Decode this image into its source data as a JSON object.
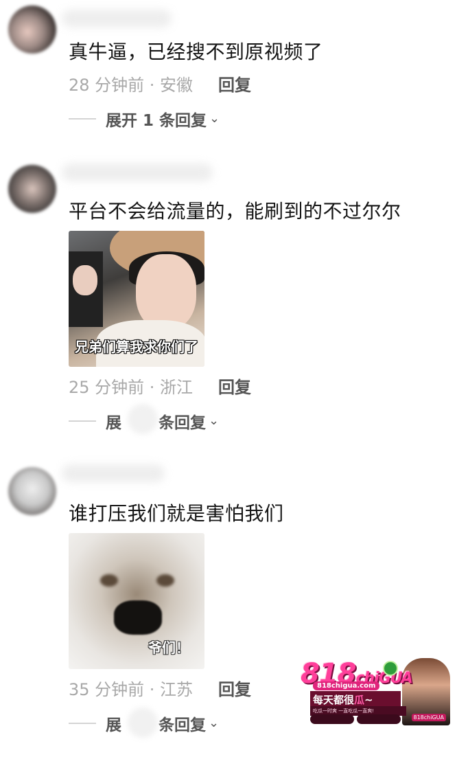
{
  "comments": [
    {
      "text": "真牛逼，已经搜不到原视频了",
      "meta": "28 分钟前 · 安徽",
      "reply_label": "回复",
      "expand_label": "展开 1 条回复",
      "expand_chevron": "⌄"
    },
    {
      "text": "平台不会给流量的，能刷到的不过尔尔",
      "sticker_caption": "兄弟们算我求你们了",
      "meta": "25 分钟前 · 浙江",
      "reply_label": "回复",
      "expand_prefix": "展",
      "expand_suffix": "条回复",
      "expand_chevron": "⌄"
    },
    {
      "text": "谁打压我们就是害怕我们",
      "sticker_caption": "爷们！",
      "meta": "35 分钟前 · 江苏",
      "reply_label": "回复",
      "expand_prefix": "展",
      "expand_suffix": "条回复",
      "expand_chevron": "⌄"
    }
  ],
  "watermark": {
    "logo_number": "818",
    "logo_text": "chiGUA",
    "url": "818chigua.com",
    "slogan_main": "每天都很",
    "slogan_gua": "瓜",
    "slogan_tail": "~",
    "subline": "吃瓜一时爽 一直吃瓜一直爽!",
    "badge": "818chiGUA"
  }
}
